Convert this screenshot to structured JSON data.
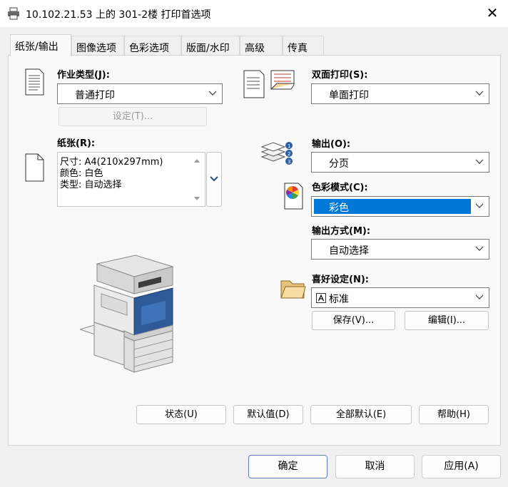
{
  "window": {
    "title": "10.102.21.53 上的 301-2楼 打印首选项",
    "close_glyph": "✕"
  },
  "tabs": [
    {
      "label": "纸张/输出",
      "active": true
    },
    {
      "label": "图像选项"
    },
    {
      "label": "色彩选项"
    },
    {
      "label": "版面/水印"
    },
    {
      "label": "高级"
    },
    {
      "label": "传真"
    }
  ],
  "job_type": {
    "label": "作业类型(J):",
    "value": "普通打印",
    "settings_button": "设定(T)..."
  },
  "duplex": {
    "label": "双面打印(S):",
    "value": "单面打印"
  },
  "paper": {
    "label": "纸张(R):",
    "lines": [
      "尺寸: A4(210x297mm)",
      "颜色: 白色",
      "类型: 自动选择"
    ]
  },
  "output": {
    "label": "输出(O):",
    "value": "分页"
  },
  "color_mode": {
    "label": "色彩模式(C):",
    "value": "彩色",
    "highlight": "#0078d7"
  },
  "output_method": {
    "label": "输出方式(M):",
    "value": "自动选择"
  },
  "favorites": {
    "label": "喜好设定(N):",
    "value": "标准",
    "save_button": "保存(V)...",
    "edit_button": "编辑(I)..."
  },
  "panel_buttons": {
    "status": "状态(U)",
    "default": "默认值(D)",
    "all_default": "全部默认(E)",
    "help": "帮助(H)"
  },
  "dialog_buttons": {
    "ok": "确定",
    "cancel": "取消",
    "apply": "应用(A)"
  },
  "icons": [
    "printer-icon",
    "close-icon",
    "job-type-icon",
    "duplex-icon",
    "paper-icon",
    "output-collate-icon",
    "color-wheel-icon",
    "folder-icon",
    "printer-device-image",
    "chevron-down-icon"
  ]
}
